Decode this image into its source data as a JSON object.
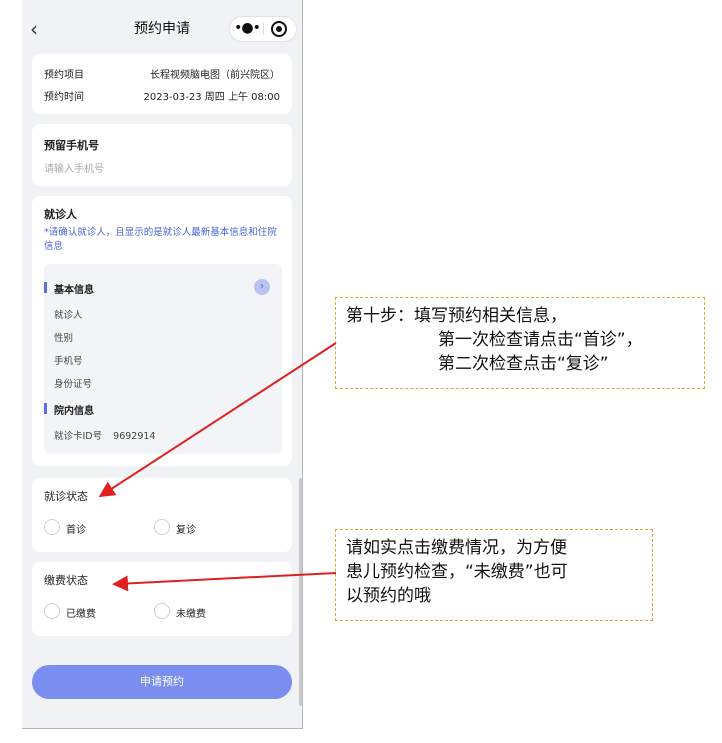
{
  "header": {
    "title": "预约申请"
  },
  "summary": {
    "item_label": "预约项目",
    "item_value": "长程视频脑电图（前兴院区）",
    "time_label": "预约时间",
    "time_value": "2023-03-23 周四 上午 08:00"
  },
  "phone": {
    "label": "预留手机号",
    "placeholder": "请输入手机号"
  },
  "patient": {
    "heading": "就诊人",
    "note": "*请确认就诊人，且显示的是就诊人最新基本信息和住院信息",
    "basic_title": "基本信息",
    "fields": [
      "就诊人",
      "性别",
      "手机号",
      "身份证号"
    ],
    "hospital_title": "院内信息",
    "card_label": "就诊卡ID号",
    "card_value": "9692914"
  },
  "visit_status": {
    "heading": "就诊状态",
    "options": [
      "首诊",
      "复诊"
    ]
  },
  "payment_status": {
    "heading": "缴费状态",
    "options": [
      "已缴费",
      "未缴费"
    ]
  },
  "submit_label": "申请预约",
  "callouts": {
    "step10": [
      "第十步：填写预约相关信息，",
      "第一次检查请点击“首诊”，",
      "第二次检查点击“复诊”"
    ],
    "payment": [
      "请如实点击缴费情况，为方便",
      "患儿预约检查，“未缴费”也可",
      "以预约的哦"
    ]
  },
  "colors": {
    "accent": "#7b8ef0",
    "annotation_arrow": "#e02020",
    "callout_border": "#d9a63a"
  }
}
